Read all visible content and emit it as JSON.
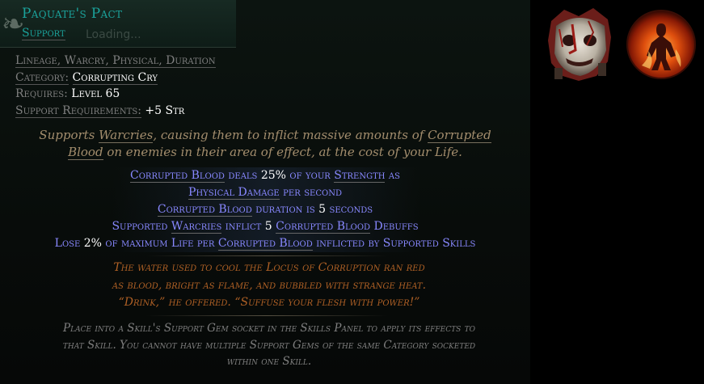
{
  "header": {
    "name": "Paquate's Pact",
    "type": "Support",
    "loading": "Loading..."
  },
  "stats": {
    "tags": "Lineage, Warcry, Physical, Duration",
    "category_label": "Category:",
    "category_value": "Corrupting Cry",
    "requires_label": "Requires:",
    "requires_value": "Level 65",
    "support_req_label": "Support Requirements:",
    "support_req_value": "+5 Str"
  },
  "description": {
    "l1_a": "Supports ",
    "l1_b": "Warcries",
    "l1_c": ", causing them to inflict massive amounts of ",
    "l1_d": "Corrupted",
    "l2_a": "Blood",
    "l2_b": " on enemies in their area of effect, at the cost of your Life."
  },
  "modifiers": {
    "m1_a": "Corrupted Blood",
    "m1_b": " deals ",
    "m1_c": "25%",
    "m1_d": " of your ",
    "m1_e": "Strength",
    "m1_f": " as",
    "m2_a": "Physical Damage",
    "m2_b": " per second",
    "m3_a": "Corrupted Blood",
    "m3_b": " duration is ",
    "m3_c": "5",
    "m3_d": " seconds",
    "m4_a": "Supported ",
    "m4_b": "Warcries",
    "m4_c": " inflict ",
    "m4_d": "5",
    "m4_e": " ",
    "m4_f": "Corrupted Blood",
    "m4_g": " Debuffs",
    "m5_a": "Lose ",
    "m5_b": "2%",
    "m5_c": " of maximum Life per ",
    "m5_d": "Corrupted Blood",
    "m5_e": " inflicted by Supported Skills"
  },
  "flavour": {
    "l1": "The water used to cool the Locus of Corruption ran red",
    "l2": "as blood, bright as flame, and bubbled with strange heat.",
    "l3": "“Drink,” he offered. “Suffuse your flesh with power!”"
  },
  "help": {
    "l1": "Place into a Skill's Support Gem socket in the Skills Panel to apply its effects to",
    "l2": "that Skill. You cannot have multiple Support Gems of the same Category socketed",
    "l3": "within one Skill."
  },
  "icons": {
    "mask": "corrupted-mask-icon",
    "orb": "fire-figure-orb-icon"
  },
  "colors": {
    "gem_name": "#1ba29b",
    "modifier": "#8888ff",
    "flavour": "#af6025",
    "description": "#a38d6d",
    "help": "#7f7f7f"
  }
}
